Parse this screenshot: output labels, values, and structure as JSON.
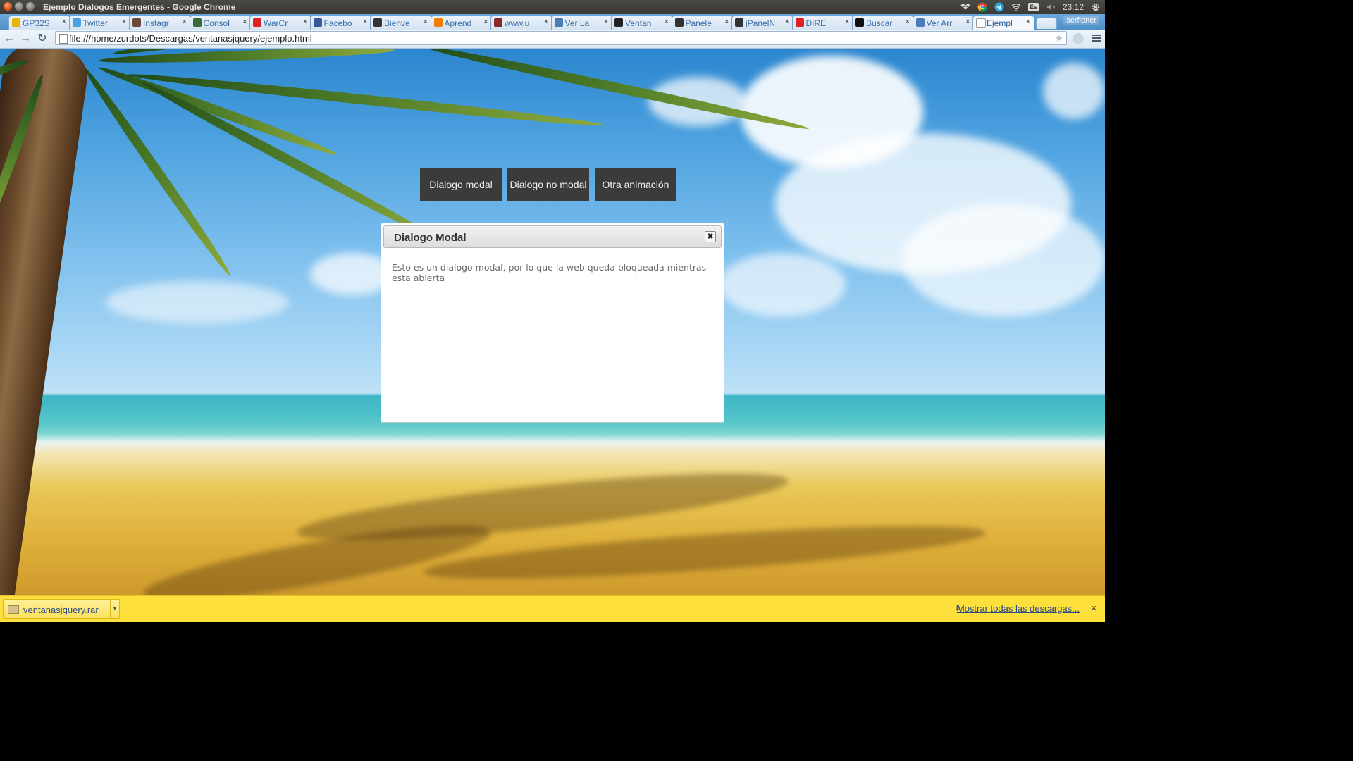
{
  "window": {
    "title": "Ejemplo Dialogos Emergentes - Google Chrome"
  },
  "tray": {
    "keyboard": "Es",
    "time": "23:12"
  },
  "tabs": [
    {
      "label": "GP32S",
      "favicon_color": "#e8b400"
    },
    {
      "label": "Twitter",
      "favicon_color": "#4aa3e0"
    },
    {
      "label": "Instagr",
      "favicon_color": "#6a4a3a"
    },
    {
      "label": "Consol",
      "favicon_color": "#3a6a3a"
    },
    {
      "label": "WarCr",
      "favicon_color": "#d22"
    },
    {
      "label": "Facebo",
      "favicon_color": "#3b5998"
    },
    {
      "label": "Bienve",
      "favicon_color": "#333"
    },
    {
      "label": "Aprend",
      "favicon_color": "#f57d00"
    },
    {
      "label": "www.u",
      "favicon_color": "#8a2a2a"
    },
    {
      "label": "Ver La",
      "favicon_color": "#4a7ab8"
    },
    {
      "label": "Ventan",
      "favicon_color": "#222"
    },
    {
      "label": "Panele",
      "favicon_color": "#333"
    },
    {
      "label": "jPanelN",
      "favicon_color": "#333"
    },
    {
      "label": "DIRE",
      "favicon_color": "#d22"
    },
    {
      "label": "Buscar",
      "favicon_color": "#111"
    },
    {
      "label": "Ver Arr",
      "favicon_color": "#4a7ab8"
    },
    {
      "label": "Ejempl",
      "favicon_color": "#ffffff",
      "active": true
    }
  ],
  "profile": {
    "name": "serfloner"
  },
  "omnibox": {
    "url": "file:///home/zurdots/Descargas/ventanasjquery/ejemplo.html"
  },
  "page": {
    "buttons": {
      "modal": "Dialogo modal",
      "nomodal": "Dialogo no modal",
      "anim": "Otra animación"
    },
    "dialog": {
      "title": "Dialogo Modal",
      "close_glyph": "✖",
      "body": "Esto es un dialogo modal, por lo que la web queda bloqueada mientras esta abierta"
    }
  },
  "downloads": {
    "file": "ventanasjquery.rar",
    "show_all": "Mostrar todas las descargas...",
    "close": "×"
  }
}
